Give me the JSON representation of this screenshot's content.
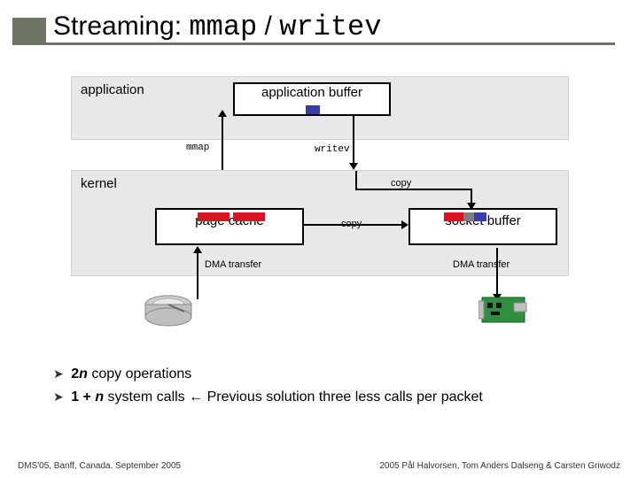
{
  "title": {
    "pre": "Streaming: ",
    "code1": "mmap",
    "mid": " / ",
    "code2": "writev"
  },
  "layers": {
    "app_label": "application",
    "kernel_label": "kernel"
  },
  "boxes": {
    "app_buffer": "application buffer",
    "page_cache": "page cache",
    "socket_buffer": "socket buffer"
  },
  "labels": {
    "mmap": "mmap",
    "writev": "writev",
    "copy_top": "copy",
    "copy_mid": "copy",
    "dma_left": "DMA transfer",
    "dma_right": "DMA transfer"
  },
  "icons": {
    "disk": "hard-disk",
    "nic": "network-card"
  },
  "bullets": {
    "b1_prefix": "2",
    "b1_n": "n",
    "b1_rest": " copy operations",
    "b2_prefix": "1 + ",
    "b2_n": "n",
    "b2_rest": " system calls  ←  Previous solution three less calls per packet"
  },
  "footer": {
    "left": "DMS'05, Banff, Canada. September 2005",
    "right": "2005  Pål Halvorsen, Tom Anders Dalseng & Carsten Griwodz"
  },
  "colors": {
    "accent": "#6d7664",
    "red": "#d81324",
    "blue": "#3a3da8",
    "grey": "#7d7d7d"
  }
}
